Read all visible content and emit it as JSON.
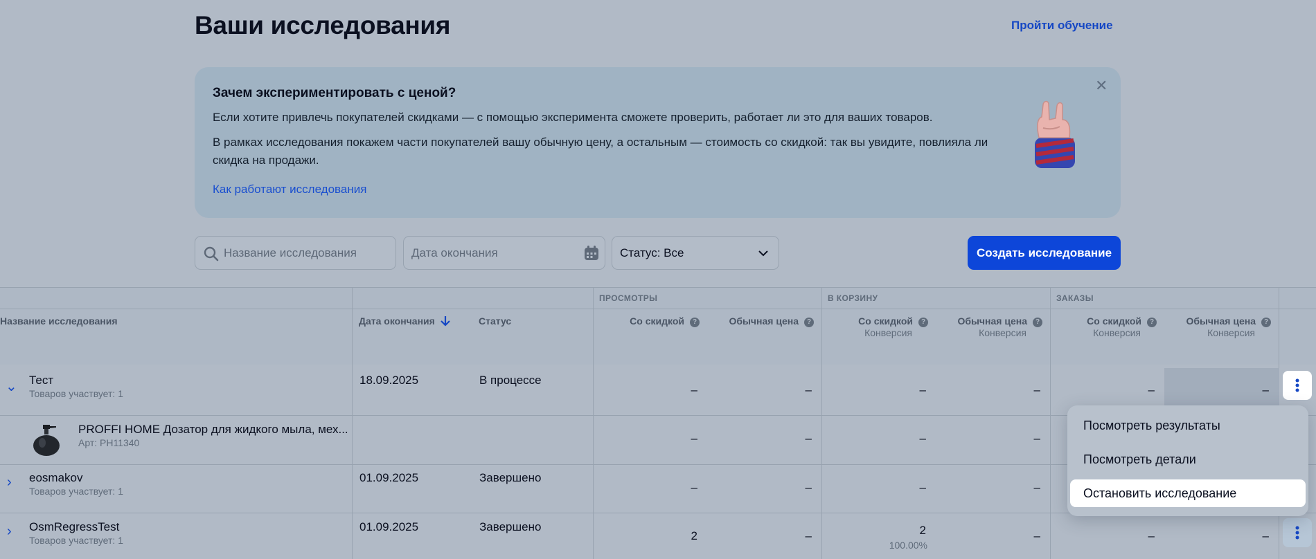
{
  "header": {
    "title": "Ваши исследования",
    "training_link": "Пройти обучение"
  },
  "banner": {
    "title": "Зачем экспериментировать с ценой?",
    "paragraph1": "Если хотите привлечь покупателей скидками — с помощью эксперимента сможете проверить, работает ли это для ваших товаров.",
    "paragraph2": "В рамках исследования покажем части покупателей вашу обычную цену, а остальным — стоимость со скидкой: так вы увидите, повлияла ли скидка на продажи.",
    "link": "Как работают исследования",
    "close_icon": "close-icon",
    "illustration": "rock-hand-icon"
  },
  "filters": {
    "search_placeholder": "Название исследования",
    "date_placeholder": "Дата окончания",
    "status_value": "Статус: Все",
    "create_button": "Создать исследование"
  },
  "table": {
    "groups": {
      "views": "ПРОСМОТРЫ",
      "cart": "В КОРЗИНУ",
      "orders": "ЗАКАЗЫ"
    },
    "columns": {
      "name": "Название исследования",
      "end_date": "Дата окончания",
      "status": "Статус",
      "discount": "Со скидкой",
      "regular": "Обычная цена",
      "conversion": "Конверсия"
    },
    "rows": [
      {
        "name": "Тест",
        "sub": "Товаров участвует: 1",
        "date": "18.09.2025",
        "status": "В процессе",
        "v1": "–",
        "v2": "–",
        "c1": "–",
        "c2": "–",
        "o1": "–",
        "o2": "–"
      },
      {
        "name": "PROFFI HOME Дозатор для жидкого мыла, мех...",
        "sub": "Арт: PH11340",
        "v1": "–",
        "v2": "–",
        "c1": "–",
        "c2": "–"
      },
      {
        "name": "eosmakov",
        "sub": "Товаров участвует: 1",
        "date": "01.09.2025",
        "status": "Завершено",
        "v1": "–",
        "v2": "–",
        "c1": "–",
        "c2": "–"
      },
      {
        "name": "OsmRegressTest",
        "sub": "Товаров участвует: 1",
        "date": "01.09.2025",
        "status": "Завершено",
        "v1": "2",
        "v2": "–",
        "c1": "2",
        "c1_sub": "100.00%",
        "c2": "–",
        "o1": "–",
        "o2": "–"
      }
    ]
  },
  "menu": {
    "view_results": "Посмотреть результаты",
    "view_details": "Посмотреть детали",
    "stop": "Остановить исследование"
  }
}
